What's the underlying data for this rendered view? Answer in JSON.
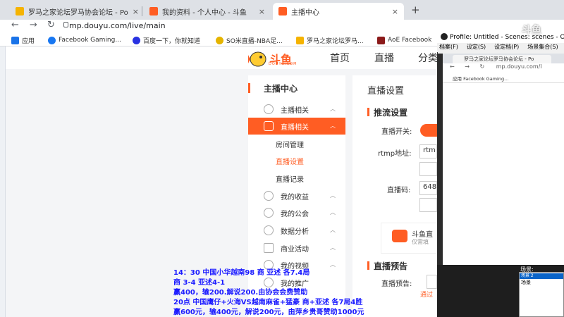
{
  "browser": {
    "tabs": [
      {
        "title": "罗马之家论坛罗马协会论坛 - Po",
        "fav_color": "#f5b301"
      },
      {
        "title": "我的资料 - 个人中心 - 斗鱼",
        "fav_color": "#ff5d23"
      },
      {
        "title": "主播中心",
        "fav_color": "#ff5d23"
      }
    ],
    "new_tab": "+",
    "close": "×",
    "back": "←",
    "forward": "→",
    "reload": "↻",
    "url": "mp.douyu.com/live/main"
  },
  "bookmarks": [
    {
      "label": "应用",
      "color": "#1a73e8"
    },
    {
      "label": "Facebook Gaming...",
      "color": "#1877f2"
    },
    {
      "label": "百度一下，你就知道",
      "color": "#2932e1"
    },
    {
      "label": "SO米直播-NBA足...",
      "color": "#e5b400"
    },
    {
      "label": "罗马之家论坛罗马...",
      "color": "#f5b301"
    },
    {
      "label": "AoE Facebook",
      "color": "#8b1a1a"
    }
  ],
  "douyu": {
    "logo": "斗鱼",
    "logo_sub": "DOUYU.COM",
    "nav": [
      "首页",
      "直播",
      "分类"
    ],
    "sidebar_title": "主播中心",
    "sidebar": [
      {
        "label": "主播相关",
        "chev": "︿"
      },
      {
        "label": "直播相关",
        "chev": "︿",
        "active": true
      }
    ],
    "sub_items": [
      "房间管理",
      "直播设置",
      "直播记录"
    ],
    "sidebar_more": [
      {
        "label": "我的收益",
        "chev": "︿"
      },
      {
        "label": "我的公会",
        "chev": "︿"
      },
      {
        "label": "数据分析",
        "chev": "︿"
      },
      {
        "label": "商业活动",
        "chev": "︿"
      },
      {
        "label": "我的视频",
        "chev": "︿"
      },
      {
        "label": "我的推广",
        "chev": ""
      }
    ],
    "panel_title": "直播设置",
    "section1": "推流设置",
    "live_switch_label": "直播开关:",
    "rtmp_label": "rtmp地址:",
    "rtmp_value": "rtm",
    "code_label": "直播码:",
    "code_value": "648",
    "promo_title": "斗鱼直",
    "promo_sub": "仅需填",
    "section2": "直播预告",
    "preview_label": "直播预告:",
    "preview_link": "通过"
  },
  "overlay_lines": [
    "14：30  中国小华越南98  商 亚述 各7.4局",
    "商 3-4  亚述4-1",
    "赢400，输200.解说200.由协会会费赞助",
    "20点  中国鹰仔+火海VS越南麻雀+猛豪  商+亚述  各7局4胜",
    "赢600元，输400元，解说200元，由萍乡贵哥赞助1000元"
  ],
  "obs": {
    "title": "Profile: Untitled - Scenes: scenes - O",
    "menu": [
      "档案(F)",
      "设定(S)",
      "设定档(P)",
      "场景集合(S)"
    ],
    "inner_tab": "罗马之家论坛罗马协会论坛 - Po",
    "inner_url": "mp.douyu.com/l",
    "inner_bookmarks": "应用   Facebook Gaming...",
    "scene_label": "场景:",
    "scene_selected": "场景 2",
    "scene_item": "场景",
    "watermark": "斗鱼"
  }
}
